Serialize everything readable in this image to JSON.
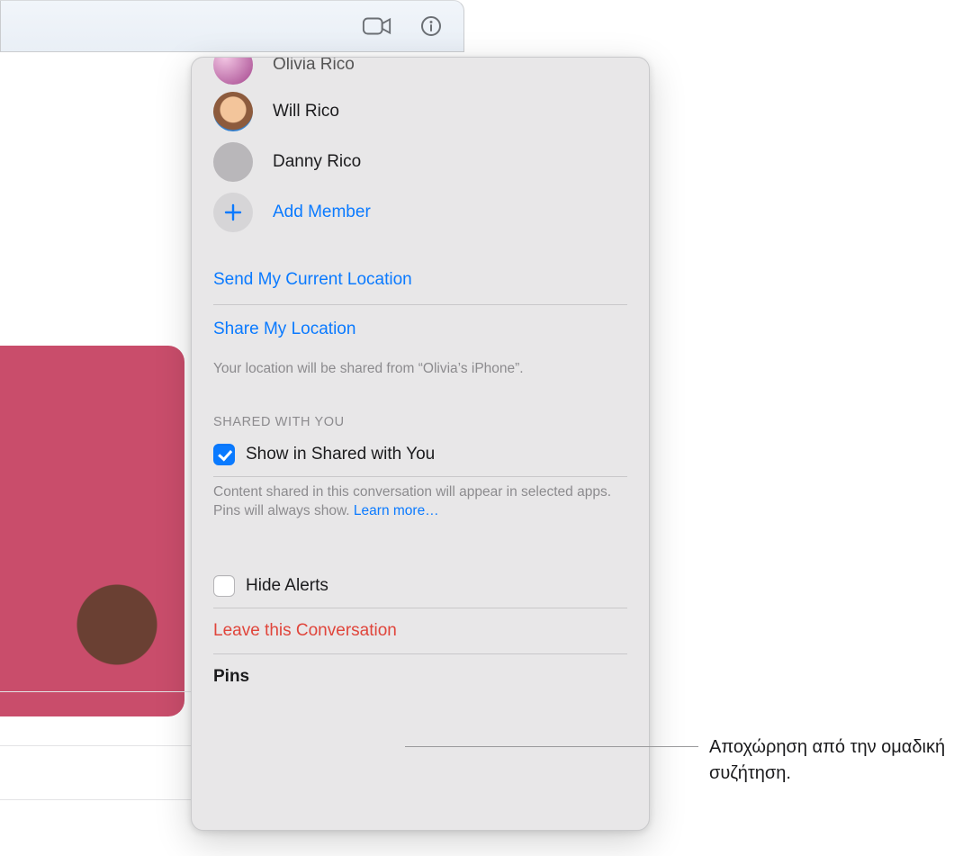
{
  "toolbar": {
    "video_icon": "video-call",
    "info_icon": "details"
  },
  "members": [
    {
      "name": "Olivia Rico",
      "avatar_style": "olivia",
      "partial": true
    },
    {
      "name": "Will Rico",
      "avatar_style": "will"
    },
    {
      "name": "Danny Rico",
      "avatar_style": "danny"
    }
  ],
  "add_member_label": "Add Member",
  "location": {
    "send_current": "Send My Current Location",
    "share": "Share My Location",
    "hint": "Your location will be shared from “Olivia’s iPhone”."
  },
  "shared_with_you": {
    "header": "SHARED WITH YOU",
    "checkbox_label": "Show in Shared with You",
    "checked": true,
    "hint_prefix": "Content shared in this conversation will appear in selected apps. Pins will always show. ",
    "learn_more": "Learn more…"
  },
  "hide_alerts": {
    "label": "Hide Alerts",
    "checked": false
  },
  "leave_label": "Leave this Conversation",
  "pins_header": "Pins",
  "callout": "Αποχώρηση από την ομαδική συζήτηση."
}
